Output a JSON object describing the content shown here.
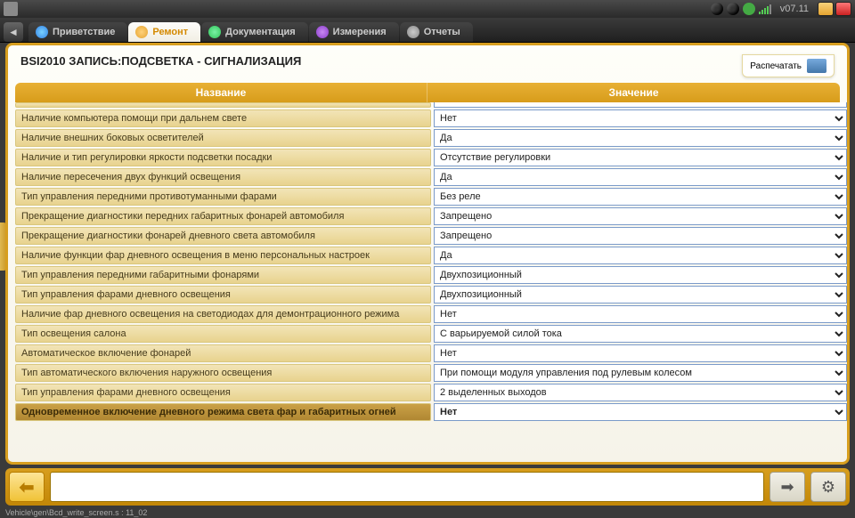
{
  "desktop": {
    "version": "v07.11"
  },
  "tabs": [
    {
      "label": "Приветствие",
      "active": false,
      "iconClass": "blue"
    },
    {
      "label": "Ремонт",
      "active": true,
      "iconClass": "orange"
    },
    {
      "label": "Документация",
      "active": false,
      "iconClass": "green"
    },
    {
      "label": "Измерения",
      "active": false,
      "iconClass": "purple"
    },
    {
      "label": "Отчеты",
      "active": false,
      "iconClass": "gray"
    }
  ],
  "page": {
    "title": "BSI2010  ЗАПИСЬ:ПОДСВЕТКА - СИГНАЛИЗАЦИЯ",
    "print_label": "Распечатать"
  },
  "table": {
    "header_name": "Название",
    "header_value": "Значение",
    "rows": [
      {
        "name": "Наличие компьютера помощи при дальнем свете",
        "value": "Нет"
      },
      {
        "name": "Наличие внешних боковых осветителей",
        "value": "Да"
      },
      {
        "name": "Наличие и тип регулировки яркости подсветки посадки",
        "value": "Отсутствие регулировки"
      },
      {
        "name": "Наличие пересечения двух функций освещения",
        "value": "Да"
      },
      {
        "name": "Тип управления передними противотуманными фарами",
        "value": "Без реле"
      },
      {
        "name": "Прекращение диагностики передних габаритных фонарей автомобиля",
        "value": "Запрещено"
      },
      {
        "name": "Прекращение диагностики фонарей дневного света автомобиля",
        "value": "Запрещено"
      },
      {
        "name": "Наличие функции фар дневного освещения в меню персональных настроек",
        "value": "Да"
      },
      {
        "name": "Тип управления передними габаритными фонарями",
        "value": "Двухпозиционный"
      },
      {
        "name": "Тип управления фарами дневного освещения",
        "value": "Двухпозиционный"
      },
      {
        "name": "Наличие фар дневного освещения на светодиодах для демонтрационного режима",
        "value": "Нет"
      },
      {
        "name": "Тип освещения салона",
        "value": "С варьируемой силой тока"
      },
      {
        "name": "Автоматическое включение фонарей",
        "value": "Нет"
      },
      {
        "name": "Тип автоматического включения наружного освещения",
        "value": "При помощи модуля управления под рулевым колесом"
      },
      {
        "name": "Тип управления фарами дневного освещения",
        "value": "2 выделенных выходов"
      },
      {
        "name": "Одновременное включение дневного режима света фар и габаритных огней",
        "value": "Нет",
        "highlight": true
      }
    ]
  },
  "footer": {
    "path": "Vehicle\\gen\\Bcd_write_screen.s : 11_02"
  }
}
